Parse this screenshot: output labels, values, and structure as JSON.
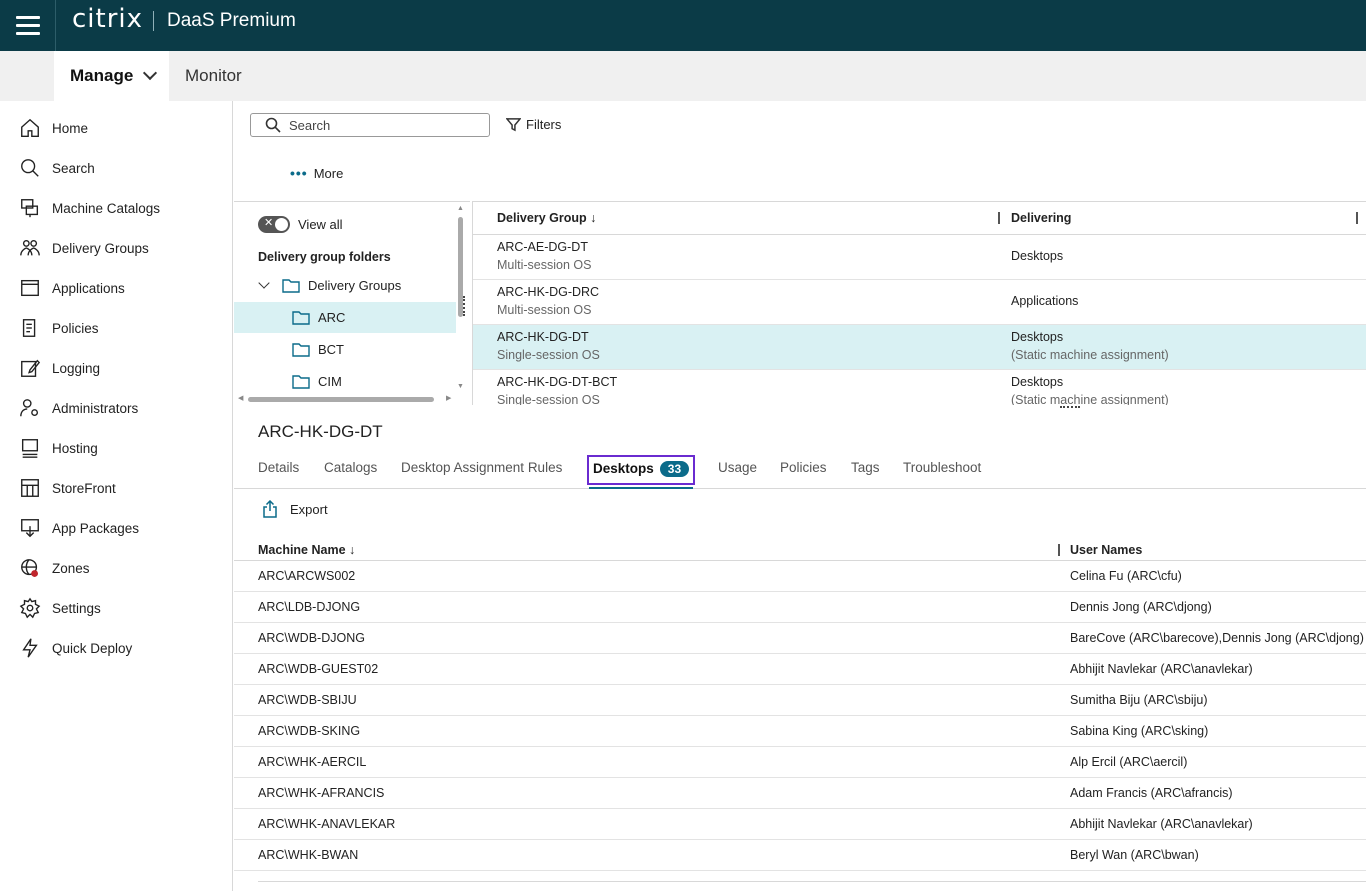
{
  "app": {
    "logo_text": "citrix",
    "product": "DaaS Premium"
  },
  "nav": {
    "manage": "Manage",
    "monitor": "Monitor"
  },
  "sidebar": {
    "items": [
      {
        "label": "Home",
        "icon": "home-icon"
      },
      {
        "label": "Search",
        "icon": "search-icon"
      },
      {
        "label": "Machine Catalogs",
        "icon": "machine-catalogs-icon"
      },
      {
        "label": "Delivery Groups",
        "icon": "delivery-groups-icon"
      },
      {
        "label": "Applications",
        "icon": "applications-icon"
      },
      {
        "label": "Policies",
        "icon": "policies-icon"
      },
      {
        "label": "Logging",
        "icon": "logging-icon"
      },
      {
        "label": "Administrators",
        "icon": "administrators-icon"
      },
      {
        "label": "Hosting",
        "icon": "hosting-icon"
      },
      {
        "label": "StoreFront",
        "icon": "storefront-icon"
      },
      {
        "label": "App Packages",
        "icon": "app-packages-icon"
      },
      {
        "label": "Zones",
        "icon": "zones-icon"
      },
      {
        "label": "Settings",
        "icon": "settings-icon"
      },
      {
        "label": "Quick Deploy",
        "icon": "quick-deploy-icon"
      }
    ]
  },
  "toolbar": {
    "search_placeholder": "Search",
    "filters": "Filters",
    "more": "More"
  },
  "folders": {
    "view_all": "View all",
    "heading": "Delivery group folders",
    "root": "Delivery Groups",
    "children": [
      "ARC",
      "BCT",
      "CIM"
    ]
  },
  "delivery_groups": {
    "col_name": "Delivery Group",
    "col_delivering": "Delivering",
    "rows": [
      {
        "name": "ARC-AE-DG-DT",
        "os": "Multi-session OS",
        "delivering": "Desktops",
        "assignment": ""
      },
      {
        "name": "ARC-HK-DG-DRC",
        "os": "Multi-session OS",
        "delivering": "Applications",
        "assignment": ""
      },
      {
        "name": "ARC-HK-DG-DT",
        "os": "Single-session OS",
        "delivering": "Desktops",
        "assignment": "(Static machine assignment)"
      },
      {
        "name": "ARC-HK-DG-DT-BCT",
        "os": "Single-session OS",
        "delivering": "Desktops",
        "assignment": "(Static machine assignment)"
      }
    ]
  },
  "details": {
    "title": "ARC-HK-DG-DT",
    "tabs": [
      "Details",
      "Catalogs",
      "Desktop Assignment Rules",
      "Desktops",
      "Usage",
      "Policies",
      "Tags",
      "Troubleshoot"
    ],
    "desktops_count": "33",
    "export": "Export"
  },
  "desktops": {
    "col_machine": "Machine Name",
    "col_users": "User Names",
    "rows": [
      {
        "machine": "ARC\\ARCWS002",
        "users": "Celina Fu (ARC\\cfu)"
      },
      {
        "machine": "ARC\\LDB-DJONG",
        "users": "Dennis Jong (ARC\\djong)"
      },
      {
        "machine": "ARC\\WDB-DJONG",
        "users": "BareCove (ARC\\barecove),Dennis Jong (ARC\\djong)"
      },
      {
        "machine": "ARC\\WDB-GUEST02",
        "users": "Abhijit Navlekar (ARC\\anavlekar)"
      },
      {
        "machine": "ARC\\WDB-SBIJU",
        "users": "Sumitha Biju (ARC\\sbiju)"
      },
      {
        "machine": "ARC\\WDB-SKING",
        "users": "Sabina King (ARC\\sking)"
      },
      {
        "machine": "ARC\\WHK-AERCIL",
        "users": "Alp Ercil (ARC\\aercil)"
      },
      {
        "machine": "ARC\\WHK-AFRANCIS",
        "users": "Adam Francis (ARC\\afrancis)"
      },
      {
        "machine": "ARC\\WHK-ANAVLEKAR",
        "users": "Abhijit Navlekar (ARC\\anavlekar)"
      },
      {
        "machine": "ARC\\WHK-BWAN",
        "users": "Beryl Wan (ARC\\bwan)"
      }
    ]
  },
  "colors": {
    "header_bg": "#0b3b47",
    "accent": "#0b6b8a",
    "selected_row": "#d9f1f3",
    "focus_ring": "#6a2bd0"
  }
}
